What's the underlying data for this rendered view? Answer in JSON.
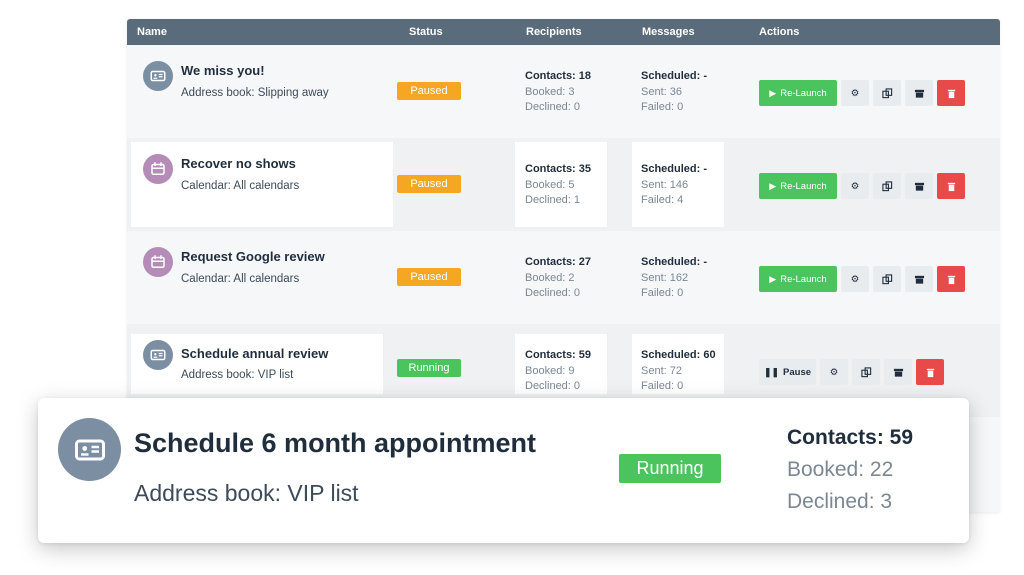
{
  "table": {
    "headers": {
      "name": "Name",
      "status": "Status",
      "recipients": "Recipients",
      "messages": "Messages",
      "actions": "Actions"
    },
    "rows": [
      {
        "title": "We miss you!",
        "subtitle": "Address book: Slipping away",
        "icon": "address-card-icon",
        "status": "Paused",
        "contacts": "Contacts: 18",
        "booked": "Booked: 3",
        "declined": "Declined: 0",
        "scheduled": "Scheduled: -",
        "sent": "Sent: 36",
        "failed": "Failed: 0",
        "action": "Re-Launch"
      },
      {
        "title": "Recover no shows",
        "subtitle": "Calendar: All calendars",
        "icon": "calendar-icon",
        "status": "Paused",
        "contacts": "Contacts: 35",
        "booked": "Booked: 5",
        "declined": "Declined: 1",
        "scheduled": "Scheduled: -",
        "sent": "Sent: 146",
        "failed": "Failed: 4",
        "action": "Re-Launch"
      },
      {
        "title": "Request Google review",
        "subtitle": "Calendar: All calendars",
        "icon": "calendar-icon",
        "status": "Paused",
        "contacts": "Contacts: 27",
        "booked": "Booked: 2",
        "declined": "Declined: 0",
        "scheduled": "Scheduled: -",
        "sent": "Sent: 162",
        "failed": "Failed: 0",
        "action": "Re-Launch"
      },
      {
        "title": "Schedule annual review",
        "subtitle": "Address book: VIP list",
        "icon": "address-card-icon",
        "status": "Running",
        "contacts": "Contacts: 59",
        "booked": "Booked: 9",
        "declined": "Declined: 0",
        "scheduled": "Scheduled: 60",
        "sent": "Sent: 72",
        "failed": "Failed: 0",
        "action": "Pause"
      }
    ]
  },
  "card": {
    "title": "Schedule 6 month appointment",
    "subtitle": "Address book: VIP list",
    "status": "Running",
    "contacts": "Contacts: 59",
    "booked": "Booked: 22",
    "declined": "Declined: 3"
  },
  "colors": {
    "header": "#5a6b7b",
    "paused": "#f5a623",
    "running": "#4cc45e",
    "delete": "#e84a4a",
    "address_avatar": "#7c8ea1",
    "calendar_avatar": "#b58cb8"
  }
}
